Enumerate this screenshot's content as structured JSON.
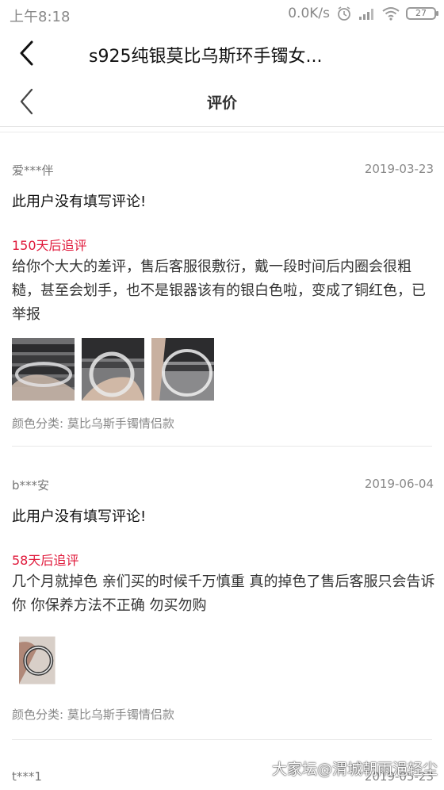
{
  "status_bar": {
    "time": "上午8:18",
    "network_speed": "0.0K/s",
    "battery": "27"
  },
  "title_bar": {
    "title": "s925纯银莫比乌斯环手镯女..."
  },
  "page_header": {
    "title": "评价"
  },
  "reviews": [
    {
      "user": "爱***伴",
      "date": "2019-03-23",
      "comment": "此用户没有填写评论!",
      "followup_label": "150天后追评",
      "followup_text": "给你个大大的差评，售后客服很敷衍，戴一段时间后内圈会很粗糙，甚至会划手，也不是银器该有的银白色啦，变成了铜红色，已举报",
      "photo_count": 3,
      "spec": "颜色分类: 莫比乌斯手镯情侣款"
    },
    {
      "user": "b***安",
      "date": "2019-06-04",
      "comment": "此用户没有填写评论!",
      "followup_label": "58天后追评",
      "followup_text": "几个月就掉色 亲们买的时候千万慎重 真的掉色了售后客服只会告诉你 你保养方法不正确 勿买勿购",
      "photo_count": 1,
      "spec": "颜色分类: 莫比乌斯手镯情侣款"
    },
    {
      "user": "t***1",
      "date": "2019-05-23"
    }
  ],
  "watermark": "大家坛@渭城朝雨浥轻尘",
  "colors": {
    "followup_red": "#e0183a",
    "meta_gray": "#888888"
  }
}
